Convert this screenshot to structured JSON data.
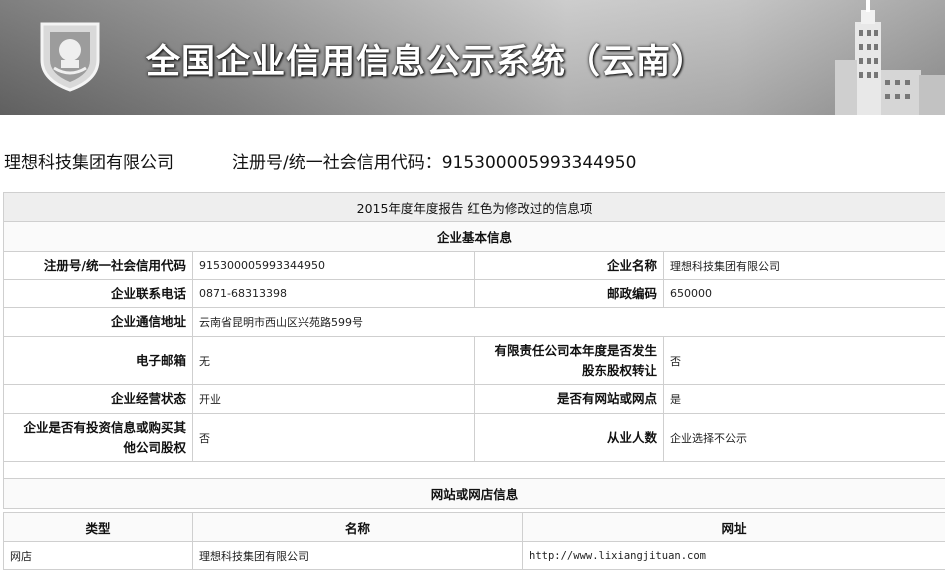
{
  "header": {
    "title": "全国企业信用信息公示系统（云南）"
  },
  "company": {
    "name": "理想科技集团有限公司",
    "reg_line": "注册号/统一社会信用代码：915300005993344950"
  },
  "report": {
    "caption": "2015年度年度报告  红色为修改过的信息项",
    "basic_section": "企业基本信息",
    "fields": {
      "reg_label": "注册号/统一社会信用代码",
      "reg_value": "915300005993344950",
      "name_label": "企业名称",
      "name_value": "理想科技集团有限公司",
      "phone_label": "企业联系电话",
      "phone_value": "0871-68313398",
      "postcode_label": "邮政编码",
      "postcode_value": "650000",
      "address_label": "企业通信地址",
      "address_value": "云南省昆明市西山区兴苑路599号",
      "email_label": "电子邮箱",
      "email_value": "无",
      "equity_transfer_label": "有限责任公司本年度是否发生股东股权转让",
      "equity_transfer_value": "否",
      "status_label": "企业经营状态",
      "status_value": "开业",
      "website_label": "是否有网站或网点",
      "website_value": "是",
      "invest_label": "企业是否有投资信息或购买其他公司股权",
      "invest_value": "否",
      "employees_label": "从业人数",
      "employees_value": "企业选择不公示"
    },
    "web_section": "网站或网店信息",
    "web_columns": [
      "类型",
      "名称",
      "网址"
    ],
    "web_rows": [
      {
        "type": "网店",
        "name": "理想科技集团有限公司",
        "url": "http://www.lixiangjituan.com"
      }
    ]
  }
}
